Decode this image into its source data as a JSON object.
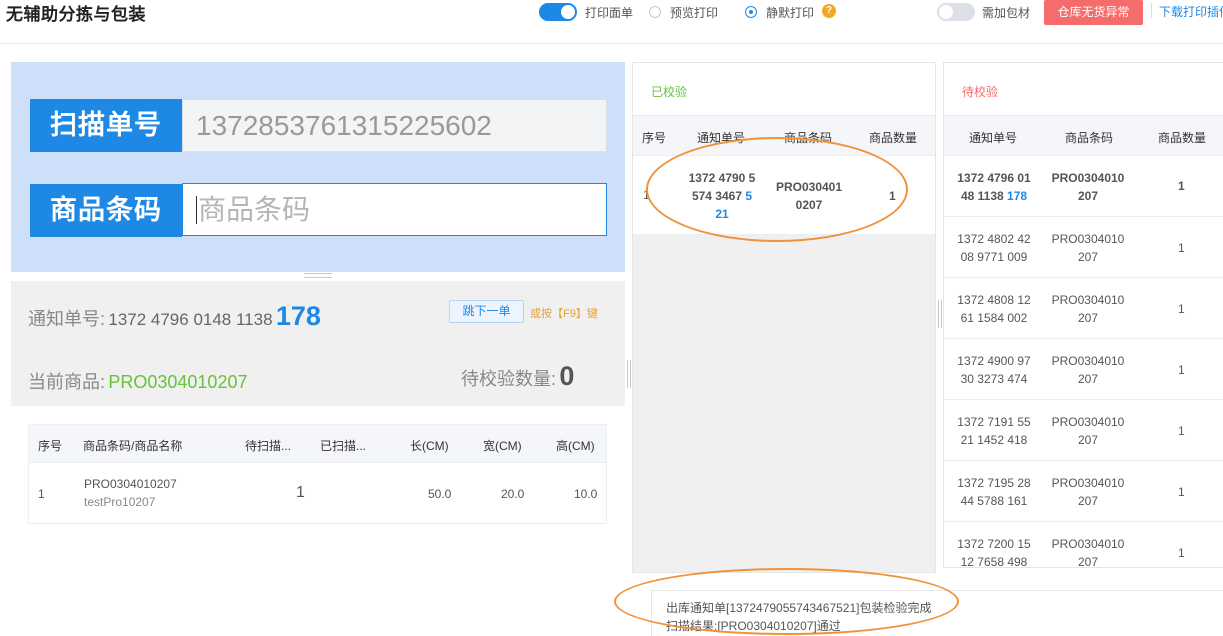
{
  "header": {
    "title": "无辅助分拣与包装",
    "print_sheet_label": "打印面单",
    "preview_print_label": "预览打印",
    "silent_print_label": "静默打印",
    "help_icon_glyph": "?",
    "need_material_label": "需加包材",
    "exception_button": "仓库无货异常",
    "download_link": "下载打印插件"
  },
  "scan": {
    "order_label": "扫描单号",
    "order_value": "1372853761315225602",
    "barcode_label": "商品条码",
    "barcode_placeholder": "商品条码"
  },
  "info": {
    "notice_label": "通知单号:",
    "notice_prefix": "1372 4796 0148 1138",
    "notice_suffix": "178",
    "next_button": "跳下一单",
    "f9_hint": "或按【F9】键",
    "current_goods_label": "当前商品:",
    "current_goods_value": "PRO0304010207",
    "pending_count_label": "待校验数量:",
    "pending_count_value": "0"
  },
  "goods_table": {
    "headers": [
      "序号",
      "商品条码/商品名称",
      "待扫描...",
      "已扫描...",
      "长(CM)",
      "宽(CM)",
      "高(CM)"
    ],
    "rows": [
      {
        "index": "1",
        "barcode": "PRO0304010207",
        "name": "testPro10207",
        "to_scan": "1",
        "scanned": "",
        "length": "50.0",
        "width": "20.0",
        "height": "10.0"
      }
    ]
  },
  "checked": {
    "title": "已校验",
    "headers": [
      "序号",
      "通知单号",
      "商品条码",
      "商品数量"
    ],
    "rows": [
      {
        "index": "1",
        "notice_l1": "1372 4790 5",
        "notice_l2": "574 3467",
        "notice_l2_tail": "5",
        "notice_l3": "21",
        "barcode_l1": "PRO030401",
        "barcode_l2": "0207",
        "qty": "1"
      }
    ]
  },
  "pending": {
    "title": "待校验",
    "headers": [
      "通知单号",
      "商品条码",
      "商品数量"
    ],
    "rows": [
      {
        "notice_l1": "1372 4796 01",
        "notice_l2": "48 1138",
        "notice_tail": "178",
        "barcode_l1": "PRO0304010",
        "barcode_l2": "207",
        "qty": "1",
        "highlight": true
      },
      {
        "notice_l1": "1372 4802 42",
        "notice_l2": "08 9771 009",
        "notice_tail": "",
        "barcode_l1": "PRO0304010",
        "barcode_l2": "207",
        "qty": "1",
        "highlight": false
      },
      {
        "notice_l1": "1372 4808 12",
        "notice_l2": "61 1584 002",
        "notice_tail": "",
        "barcode_l1": "PRO0304010",
        "barcode_l2": "207",
        "qty": "1",
        "highlight": false
      },
      {
        "notice_l1": "1372 4900 97",
        "notice_l2": "30 3273 474",
        "notice_tail": "",
        "barcode_l1": "PRO0304010",
        "barcode_l2": "207",
        "qty": "1",
        "highlight": false
      },
      {
        "notice_l1": "1372 7191 55",
        "notice_l2": "21 1452 418",
        "notice_tail": "",
        "barcode_l1": "PRO0304010",
        "barcode_l2": "207",
        "qty": "1",
        "highlight": false
      },
      {
        "notice_l1": "1372 7195 28",
        "notice_l2": "44 5788 161",
        "notice_tail": "",
        "barcode_l1": "PRO0304010",
        "barcode_l2": "207",
        "qty": "1",
        "highlight": false
      },
      {
        "notice_l1": "1372 7200 15",
        "notice_l2": "12 7658 498",
        "notice_tail": "",
        "barcode_l1": "PRO0304010",
        "barcode_l2": "207",
        "qty": "1",
        "highlight": false
      }
    ]
  },
  "log": {
    "line1": "出库通知单[1372479055743467521]包装检验完成",
    "line2": "扫描结果:[PRO0304010207]通过"
  },
  "colors": {
    "accent": "#1e88e5",
    "danger": "#f56c6c",
    "success": "#67c23a",
    "warning": "#e6a23c",
    "annotation": "#f0923b"
  }
}
